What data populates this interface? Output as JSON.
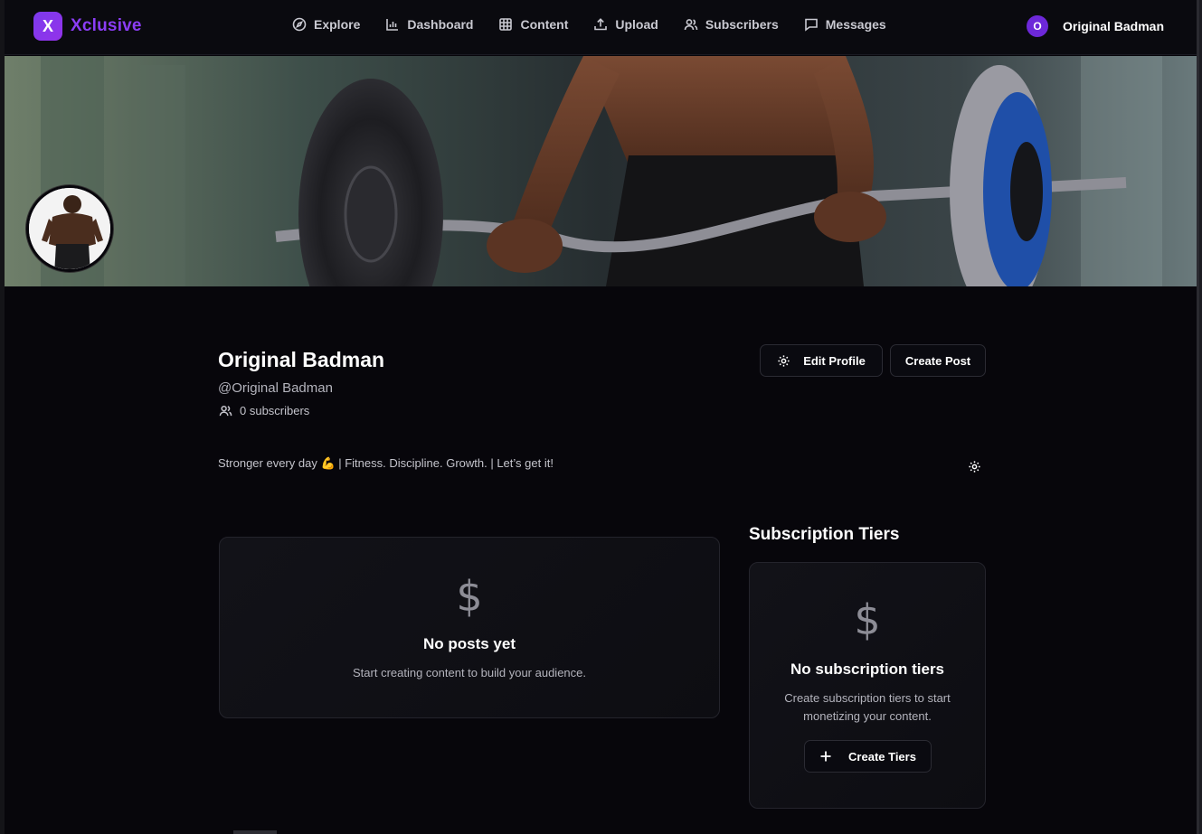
{
  "brand": {
    "logo_letter": "X",
    "name": "Xclusive"
  },
  "nav": {
    "items": [
      {
        "label": "Explore",
        "icon": "compass-icon"
      },
      {
        "label": "Dashboard",
        "icon": "bar-chart-icon"
      },
      {
        "label": "Content",
        "icon": "grid-icon"
      },
      {
        "label": "Upload",
        "icon": "upload-icon"
      },
      {
        "label": "Subscribers",
        "icon": "users-icon"
      },
      {
        "label": "Messages",
        "icon": "message-icon"
      }
    ]
  },
  "user": {
    "initial": "O",
    "name": "Original Badman"
  },
  "profile": {
    "name": "Original Badman",
    "handle": "@Original Badman",
    "subscribers": "0 subscribers",
    "bio": "Stronger every day 💪 | Fitness. Discipline. Growth. | Let’s get it!",
    "edit_label": "Edit Profile",
    "create_post_label": "Create Post"
  },
  "posts": {
    "icon_glyph": "$",
    "title": "No posts yet",
    "text": "Start creating content to build your audience."
  },
  "tiers": {
    "heading": "Subscription Tiers",
    "icon_glyph": "$",
    "title": "No subscription tiers",
    "text_line1": "Create subscription tiers to start",
    "text_line2": "monetizing your content.",
    "button_label": "Create Tiers"
  },
  "colors": {
    "accent": "#7c3aed",
    "background": "#07060b"
  }
}
